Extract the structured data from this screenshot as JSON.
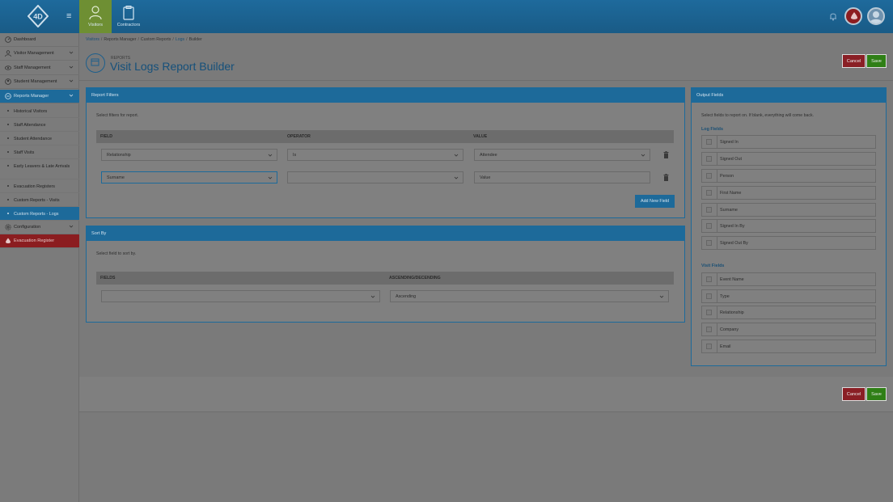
{
  "topbar": {
    "tabs": [
      {
        "label": "Visitors",
        "icon": "person-icon",
        "active": true
      },
      {
        "label": "Contractors",
        "icon": "clipboard-icon",
        "active": false
      }
    ],
    "icons": [
      "logo-4d",
      "menu-icon",
      "bell-icon",
      "alert-drop-icon",
      "user-avatar-icon"
    ]
  },
  "sidebar": {
    "items": [
      {
        "label": "Dashboard",
        "icon": "dashboard-icon"
      },
      {
        "label": "Visitor Management",
        "icon": "person-icon"
      },
      {
        "label": "Staff Management",
        "icon": "eye-icon"
      },
      {
        "label": "Student Management",
        "icon": "student-icon"
      },
      {
        "label": "Reports Manager",
        "icon": "reports-icon"
      }
    ],
    "sub_items": [
      {
        "label": "Historical Visitors"
      },
      {
        "label": "Staff Attendance"
      },
      {
        "label": "Student Attendance"
      },
      {
        "label": "Staff Visits"
      },
      {
        "label": "Early Leavers & Late Arrivals"
      },
      {
        "label": "Evacuation Registers"
      },
      {
        "label": "Custom Reports - Visits"
      },
      {
        "label": "Custom Reports - Logs"
      }
    ],
    "configuration": {
      "label": "Configuration",
      "icon": "gear-icon"
    },
    "evacuation": {
      "label": "Evacuation Register",
      "icon": "drop-icon"
    }
  },
  "breadcrumb": {
    "items": [
      "Visitors",
      "Reports Manager",
      "Custom Reports",
      "Logs",
      "Builder"
    ],
    "separator": "/"
  },
  "header": {
    "subtitle": "REPORTS",
    "title": "Visit Logs Report Builder",
    "cancel_label": "Cancel",
    "save_label": "Save"
  },
  "report_filters": {
    "title": "Report Filters",
    "hint": "Select filters for report.",
    "columns": [
      "FIELD",
      "OPERATOR",
      "VALUE"
    ],
    "rows": [
      {
        "field": "Relationship",
        "operator": "Is",
        "value": "Attendee"
      },
      {
        "field": "Surname",
        "operator": "",
        "value": "Value"
      }
    ],
    "add_label": "Add New Field"
  },
  "sort_by": {
    "title": "Sort By",
    "hint": "Select field to sort by.",
    "columns": [
      "FIELDS",
      "ASCENDING/DECENDING"
    ],
    "field": "",
    "order": "Ascending"
  },
  "output_fields": {
    "title": "Output Fields",
    "hint": "Select fields to report on. If blank, everything will come back.",
    "log_label": "Log Fields",
    "log_fields": [
      "Signed In",
      "Signed Out",
      "Person",
      "First Name",
      "Surname",
      "Signed In By",
      "Signed Out By"
    ],
    "visit_label": "Visit Fields",
    "visit_fields": [
      "Event Name",
      "Type",
      "Relationship",
      "Company",
      "Email"
    ]
  },
  "footer": {
    "cancel_label": "Cancel",
    "save_label": "Save"
  },
  "colors": {
    "brand_blue": "#1d6a9a",
    "cancel_red": "#8a1f25",
    "save_green": "#2f7f16",
    "active_tab_green": "#6e8f33"
  }
}
